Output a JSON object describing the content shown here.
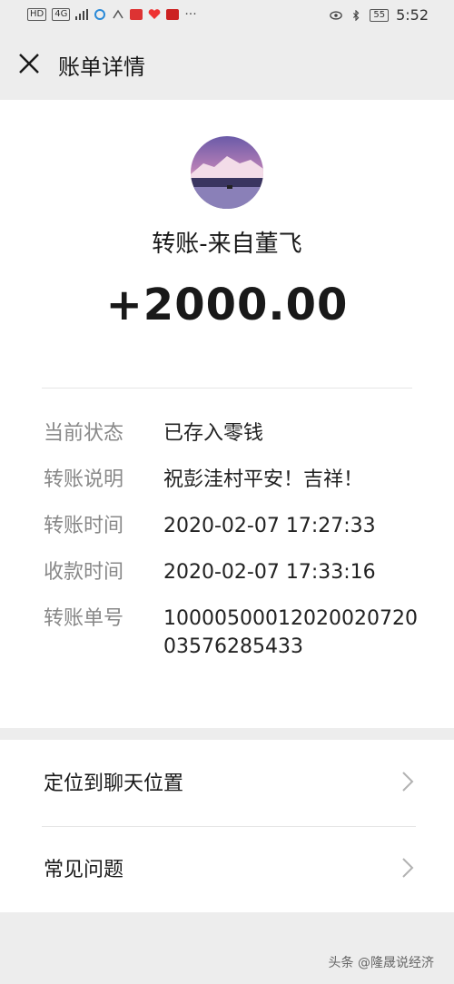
{
  "status_bar": {
    "left_chips": [
      "HD",
      "4G"
    ],
    "time": "5:52",
    "battery": "55"
  },
  "nav": {
    "title": "账单详情"
  },
  "transfer": {
    "title": "转账-来自董飞",
    "amount": "+2000.00"
  },
  "details": [
    {
      "label": "当前状态",
      "value": "已存入零钱"
    },
    {
      "label": "转账说明",
      "value": "祝彭洼村平安！吉祥！"
    },
    {
      "label": "转账时间",
      "value": "2020-02-07 17:27:33"
    },
    {
      "label": "收款时间",
      "value": "2020-02-07 17:33:16"
    },
    {
      "label": "转账单号",
      "value": "1000050001202002072003576285433"
    }
  ],
  "actions": [
    {
      "label": "定位到聊天位置"
    },
    {
      "label": "常见问题"
    }
  ],
  "watermark": "头条 @隆晟说经济"
}
